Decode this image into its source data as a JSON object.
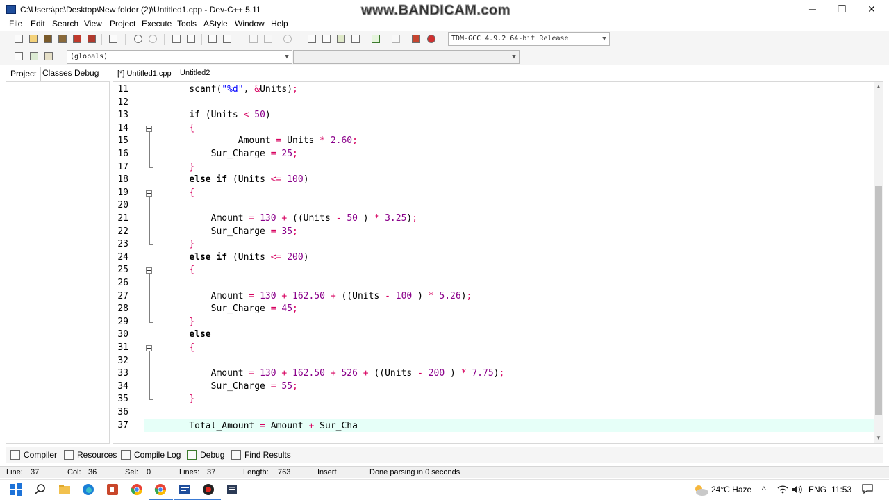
{
  "window": {
    "title": "C:\\Users\\pc\\Desktop\\New folder (2)\\Untitled1.cpp - Dev-C++ 5.11",
    "watermark": "www.BANDICAM.com",
    "minimize_glyph": "─",
    "maximize_glyph": "❐",
    "close_glyph": "✕"
  },
  "menu": [
    "File",
    "Edit",
    "Search",
    "View",
    "Project",
    "Execute",
    "Tools",
    "AStyle",
    "Window",
    "Help"
  ],
  "toolbar": {
    "compiler_select": "TDM-GCC 4.9.2 64-bit Release",
    "scope_select": "(globals)",
    "member_select": ""
  },
  "left_tabs": [
    "Project",
    "Classes",
    "Debug"
  ],
  "editor_tabs": [
    "[*] Untitled1.cpp",
    "Untitled2"
  ],
  "code_lines": [
    {
      "n": "11",
      "html": "    scanf(<span class=\"str\">\"%d\"</span>, <span class=\"op\">&amp;</span>Units)<span class=\"op\">;</span>"
    },
    {
      "n": "12",
      "html": ""
    },
    {
      "n": "13",
      "html": "    <span class=\"kw\">if</span> (Units <span class=\"op\">&lt;</span> <span class=\"num\">50</span>)"
    },
    {
      "n": "14",
      "html": "    <span class=\"pn\">{</span>"
    },
    {
      "n": "15",
      "html": "             Amount <span class=\"op\">=</span> Units <span class=\"op\">*</span> <span class=\"num\">2.60</span><span class=\"op\">;</span>"
    },
    {
      "n": "16",
      "html": "        Sur_Charge <span class=\"op\">=</span> <span class=\"num\">25</span><span class=\"op\">;</span>"
    },
    {
      "n": "17",
      "html": "    <span class=\"pn\">}</span>"
    },
    {
      "n": "18",
      "html": "    <span class=\"kw\">else if</span> (Units <span class=\"op\">&lt;=</span> <span class=\"num\">100</span>)"
    },
    {
      "n": "19",
      "html": "    <span class=\"pn\">{</span>"
    },
    {
      "n": "20",
      "html": ""
    },
    {
      "n": "21",
      "html": "        Amount <span class=\"op\">=</span> <span class=\"num\">130</span> <span class=\"op\">+</span> ((Units <span class=\"op\">-</span> <span class=\"num\">50</span> ) <span class=\"op\">*</span> <span class=\"num\">3.25</span>)<span class=\"op\">;</span>"
    },
    {
      "n": "22",
      "html": "        Sur_Charge <span class=\"op\">=</span> <span class=\"num\">35</span><span class=\"op\">;</span>"
    },
    {
      "n": "23",
      "html": "    <span class=\"pn\">}</span>"
    },
    {
      "n": "24",
      "html": "    <span class=\"kw\">else if</span> (Units <span class=\"op\">&lt;=</span> <span class=\"num\">200</span>)"
    },
    {
      "n": "25",
      "html": "    <span class=\"pn\">{</span>"
    },
    {
      "n": "26",
      "html": ""
    },
    {
      "n": "27",
      "html": "        Amount <span class=\"op\">=</span> <span class=\"num\">130</span> <span class=\"op\">+</span> <span class=\"num\">162.50</span> <span class=\"op\">+</span> ((Units <span class=\"op\">-</span> <span class=\"num\">100</span> ) <span class=\"op\">*</span> <span class=\"num\">5.26</span>)<span class=\"op\">;</span>"
    },
    {
      "n": "28",
      "html": "        Sur_Charge <span class=\"op\">=</span> <span class=\"num\">45</span><span class=\"op\">;</span>"
    },
    {
      "n": "29",
      "html": "    <span class=\"pn\">}</span>"
    },
    {
      "n": "30",
      "html": "    <span class=\"kw\">else</span>"
    },
    {
      "n": "31",
      "html": "    <span class=\"pn\">{</span>"
    },
    {
      "n": "32",
      "html": ""
    },
    {
      "n": "33",
      "html": "        Amount <span class=\"op\">=</span> <span class=\"num\">130</span> <span class=\"op\">+</span> <span class=\"num\">162.50</span> <span class=\"op\">+</span> <span class=\"num\">526</span> <span class=\"op\">+</span> ((Units <span class=\"op\">-</span> <span class=\"num\">200</span> ) <span class=\"op\">*</span> <span class=\"num\">7.75</span>)<span class=\"op\">;</span>"
    },
    {
      "n": "34",
      "html": "        Sur_Charge <span class=\"op\">=</span> <span class=\"num\">55</span><span class=\"op\">;</span>"
    },
    {
      "n": "35",
      "html": "    <span class=\"pn\">}</span>"
    },
    {
      "n": "36",
      "html": ""
    },
    {
      "n": "37",
      "html": "    Total_Amount <span class=\"op\">=</span> Amount <span class=\"op\">+</span> Sur_Cha<span class=\"caret\"></span>",
      "current": true
    }
  ],
  "bottom_tabs": [
    "Compiler",
    "Resources",
    "Compile Log",
    "Debug",
    "Find Results"
  ],
  "status": {
    "line_label": "Line:",
    "line_value": "37",
    "col_label": "Col:",
    "col_value": "36",
    "sel_label": "Sel:",
    "sel_value": "0",
    "lines_label": "Lines:",
    "lines_value": "37",
    "length_label": "Length:",
    "length_value": "763",
    "mode": "Insert",
    "message": "Done parsing in 0 seconds"
  },
  "taskbar": {
    "weather": "24°C  Haze",
    "language": "ENG",
    "time": "11:53"
  },
  "colors": {
    "current_line": "#e6fff8",
    "number": "#8a008a",
    "string": "#0000ff",
    "operator": "#d7005f"
  }
}
